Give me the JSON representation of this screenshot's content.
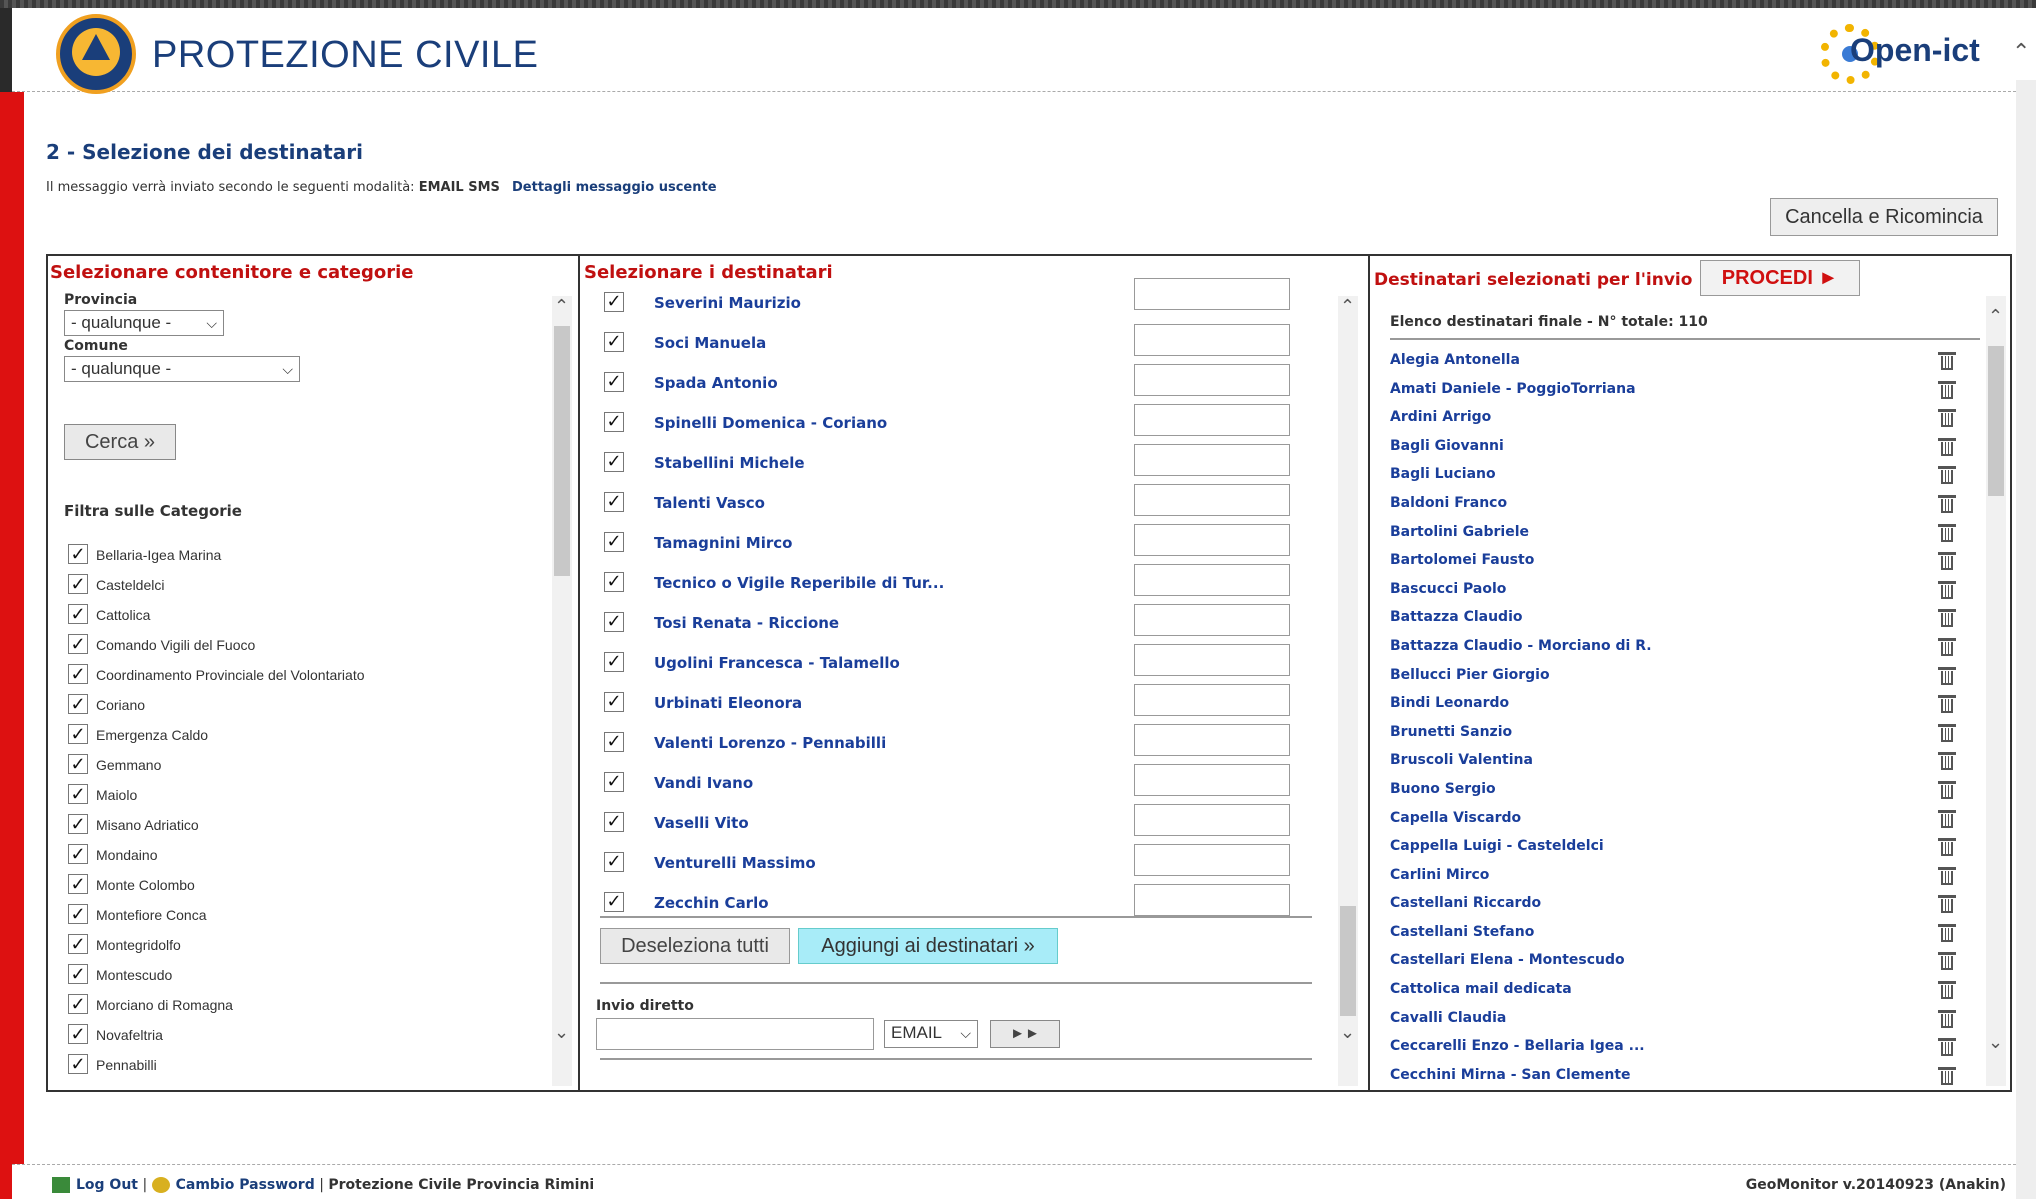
{
  "header": {
    "brand_title": "PROTEZIONE CIVILE",
    "partner_logo": "Open-ict"
  },
  "step": {
    "title": "2 - Selezione dei destinatari",
    "info_prefix": "Il messaggio verrà inviato secondo le seguenti modalità:",
    "modes": "EMAIL SMS",
    "details_link": "Dettagli messaggio uscente"
  },
  "restart_button": "Cancella e Ricomincia",
  "panel_left": {
    "title": "Selezionare contenitore e categorie",
    "provincia_label": "Provincia",
    "provincia_value": "- qualunque -",
    "comune_label": "Comune",
    "comune_value": "- qualunque -",
    "search_button": "Cerca »",
    "filter_title": "Filtra sulle Categorie",
    "categories": [
      "Bellaria-Igea Marina",
      "Casteldelci",
      "Cattolica",
      "Comando Vigili del Fuoco",
      "Coordinamento Provinciale del Volontariato",
      "Coriano",
      "Emergenza Caldo",
      "Gemmano",
      "Maiolo",
      "Misano Adriatico",
      "Mondaino",
      "Monte Colombo",
      "Montefiore Conca",
      "Montegridolfo",
      "Montescudo",
      "Morciano di Romagna",
      "Novafeltria",
      "Pennabilli"
    ]
  },
  "panel_middle": {
    "title": "Selezionare i destinatari",
    "recipients": [
      "Severini Maurizio",
      "Soci Manuela",
      "Spada Antonio",
      "Spinelli Domenica - Coriano",
      "Stabellini Michele",
      "Talenti Vasco",
      "Tamagnini Mirco",
      "Tecnico o Vigile Reperibile di Tur...",
      "Tosi Renata - Riccione",
      "Ugolini Francesca - Talamello",
      "Urbinati Eleonora",
      "Valenti Lorenzo - Pennabilli",
      "Vandi Ivano",
      "Vaselli Vito",
      "Venturelli Massimo",
      "Zecchin Carlo"
    ],
    "deselect_button": "Deseleziona tutti",
    "add_button": "Aggiungi ai destinatari »",
    "direct_label": "Invio diretto",
    "direct_input_value": "",
    "direct_mode": "EMAIL",
    "direct_send": "►►"
  },
  "panel_right": {
    "title": "Destinatari selezionati per l'invio",
    "proceed_button": "PROCEDI ►",
    "list_header": "Elenco destinatari finale - N° totale: 110",
    "selected": [
      "Alegia Antonella",
      "Amati Daniele - PoggioTorriana",
      "Ardini Arrigo",
      "Bagli Giovanni",
      "Bagli Luciano",
      "Baldoni Franco",
      "Bartolini Gabriele",
      "Bartolomei Fausto",
      "Bascucci Paolo",
      "Battazza Claudio",
      "Battazza Claudio - Morciano di R.",
      "Bellucci Pier Giorgio",
      "Bindi Leonardo",
      "Brunetti Sanzio",
      "Bruscoli Valentina",
      "Buono Sergio",
      "Capella Viscardo",
      "Cappella Luigi - Casteldelci",
      "Carlini Mirco",
      "Castellani Riccardo",
      "Castellani Stefano",
      "Castellari Elena - Montescudo",
      "Cattolica mail dedicata",
      "Cavalli Claudia",
      "Ceccarelli Enzo - Bellaria Igea ...",
      "Cecchini Mirna - San Clemente"
    ]
  },
  "footer": {
    "logout": "Log Out",
    "change_password": "Cambio Password",
    "org": "Protezione Civile Provincia Rimini",
    "version": "GeoMonitor v.20140923 (Anakin)"
  }
}
